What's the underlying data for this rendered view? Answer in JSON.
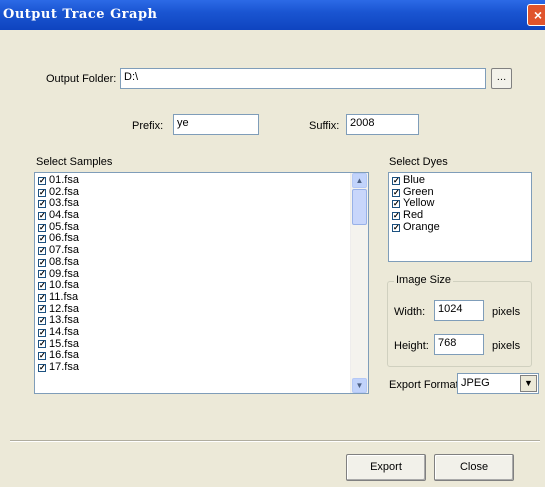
{
  "window": {
    "title": "Output Trace Graph",
    "close_icon": "×"
  },
  "output_folder": {
    "label": "Output Folder:",
    "value": "D:\\",
    "browse_icon": "…"
  },
  "prefix": {
    "label": "Prefix:",
    "value": "ye"
  },
  "suffix": {
    "label": "Suffix:",
    "value": "2008"
  },
  "samples": {
    "label": "Select Samples",
    "items": [
      "01.fsa",
      "02.fsa",
      "03.fsa",
      "04.fsa",
      "05.fsa",
      "06.fsa",
      "07.fsa",
      "08.fsa",
      "09.fsa",
      "10.fsa",
      "11.fsa",
      "12.fsa",
      "13.fsa",
      "14.fsa",
      "15.fsa",
      "16.fsa",
      "17.fsa"
    ],
    "checked": true
  },
  "dyes": {
    "label": "Select Dyes",
    "items": [
      "Blue",
      "Green",
      "Yellow",
      "Red",
      "Orange"
    ],
    "checked": true
  },
  "image_size": {
    "label": "Image Size",
    "width_label": "Width:",
    "width_value": "1024",
    "height_label": "Height:",
    "height_value": "768",
    "unit": "pixels"
  },
  "export_format": {
    "label": "Export Format:",
    "value": "JPEG"
  },
  "buttons": {
    "export": "Export",
    "close": "Close"
  },
  "colors": {
    "titlebar": "#1a55d2",
    "dialog_bg": "#ece9d8",
    "close_button": "#e0542c"
  }
}
